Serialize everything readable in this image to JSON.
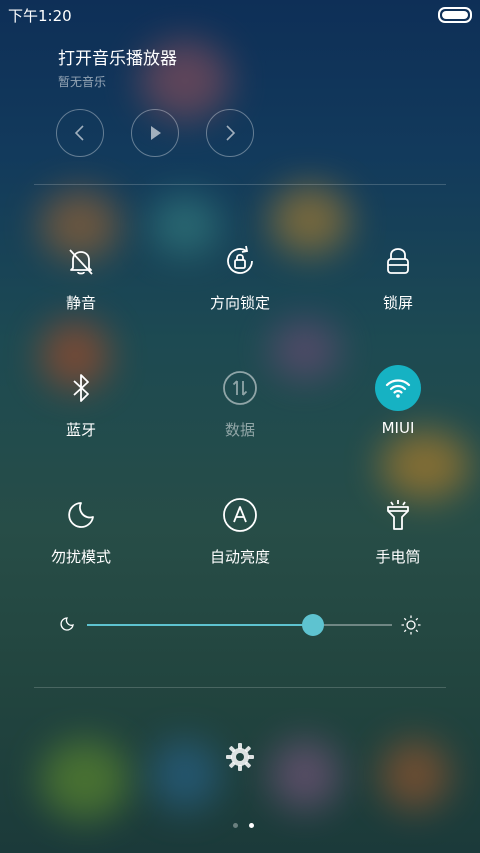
{
  "status_bar": {
    "time": "下午1:20",
    "battery_icon": "battery-icon"
  },
  "music": {
    "title": "打开音乐播放器",
    "subtitle": "暂无音乐",
    "controls": [
      "previous-icon",
      "play-icon",
      "next-icon"
    ]
  },
  "toggles": [
    {
      "label": "静音",
      "icon": "bell-off-icon",
      "state": "off"
    },
    {
      "label": "方向锁定",
      "icon": "rotation-lock-icon",
      "state": "off"
    },
    {
      "label": "锁屏",
      "icon": "lock-icon",
      "state": "off"
    },
    {
      "label": "蓝牙",
      "icon": "bluetooth-icon",
      "state": "off"
    },
    {
      "label": "数据",
      "icon": "mobile-data-icon",
      "state": "disabled"
    },
    {
      "label": "MIUI",
      "icon": "wifi-icon",
      "state": "on"
    },
    {
      "label": "勿扰模式",
      "icon": "moon-icon",
      "state": "off"
    },
    {
      "label": "自动亮度",
      "icon": "auto-brightness-icon",
      "state": "off"
    },
    {
      "label": "手电筒",
      "icon": "flashlight-icon",
      "state": "off"
    }
  ],
  "brightness": {
    "level": 0.74,
    "min_icon": "moon-icon",
    "max_icon": "sun-icon"
  },
  "settings_icon": "gear-icon",
  "pager": {
    "pages": 2,
    "current": 2
  },
  "colors": {
    "accent": "#16b2c3",
    "slider": "#5ec3d0"
  }
}
